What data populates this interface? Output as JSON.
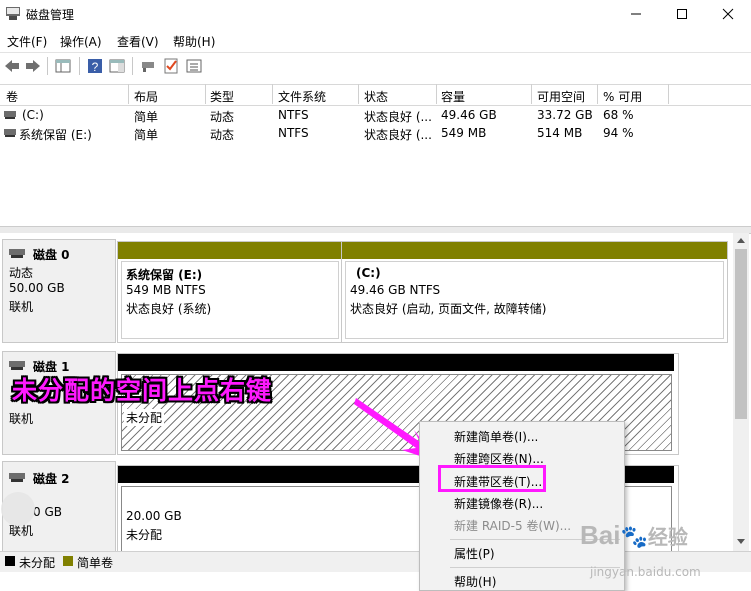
{
  "window": {
    "title": "磁盘管理"
  },
  "menu": [
    "文件(F)",
    "操作(A)",
    "查看(V)",
    "帮助(H)"
  ],
  "volume_table": {
    "columns": [
      "卷",
      "布局",
      "类型",
      "文件系统",
      "状态",
      "容量",
      "可用空间",
      "% 可用"
    ],
    "rows": [
      [
        "(C:)",
        "简单",
        "动态",
        "NTFS",
        "状态良好 (...",
        "49.46 GB",
        "33.72 GB",
        "68 %"
      ],
      [
        "系统保留 (E:)",
        "简单",
        "动态",
        "NTFS",
        "状态良好 (...",
        "549 MB",
        "514 MB",
        "94 %"
      ]
    ]
  },
  "disks": [
    {
      "name": "磁盘 0",
      "type": "动态",
      "size": "50.00 GB",
      "status": "联机",
      "partitions": [
        {
          "name": "系统保留  (E:)",
          "size": "549 MB NTFS",
          "status": "状态良好 (系统)"
        },
        {
          "name": "(C:)",
          "size": "49.46 GB NTFS",
          "status": "状态良好 (启动, 页面文件, 故障转储)"
        }
      ]
    },
    {
      "name": "磁盘 1",
      "status": "联机",
      "unalloc_label": "未分配"
    },
    {
      "name": "磁盘 2",
      "size": "0 GB",
      "status": "联机",
      "unalloc_size": "20.00 GB",
      "unalloc_label": "未分配"
    }
  ],
  "legend": [
    {
      "label": "未分配",
      "color": "#000000"
    },
    {
      "label": "简单卷",
      "color": "#808000"
    }
  ],
  "context_menu": {
    "items": [
      "新建简单卷(I)...",
      "新建跨区卷(N)...",
      "新建带区卷(T)...",
      "新建镜像卷(R)...",
      "新建 RAID-5 卷(W)..."
    ],
    "disabled_item": "新建 RAID-5 卷(W)...",
    "properties": "属性(P)",
    "help": "帮助(H)"
  },
  "annotation": "未分配的空间上点右键",
  "watermark": {
    "brand": "Bai",
    "brand2": "经验",
    "url": "jingyan.baidu.com"
  },
  "colors": {
    "accent": "#ff19ff",
    "simple_volume": "#808000",
    "unallocated": "#000000"
  }
}
